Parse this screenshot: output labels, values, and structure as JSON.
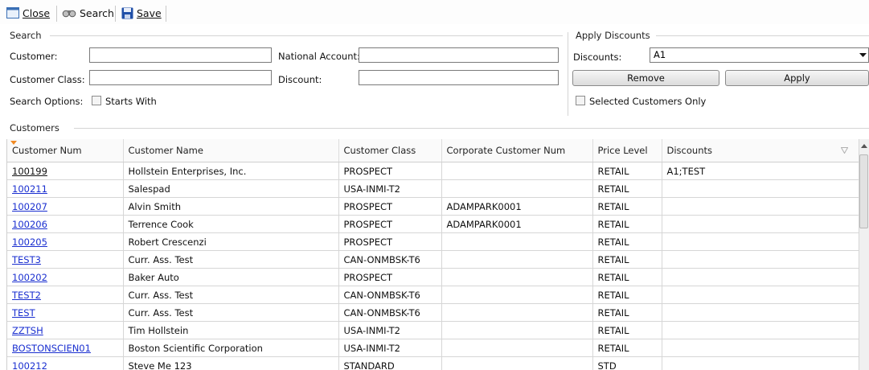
{
  "toolbar": {
    "close_label": "Close",
    "search_label": "Search",
    "save_label": "Save"
  },
  "search": {
    "group_title": "Search",
    "customer_label": "Customer:",
    "customer_value": "",
    "customer_class_label": "Customer Class:",
    "customer_class_value": "",
    "national_account_label": "National Account:",
    "national_account_value": "",
    "discount_label": "Discount:",
    "discount_value": "",
    "search_options_label": "Search Options:",
    "starts_with_label": "Starts With"
  },
  "apply_discounts": {
    "group_title": "Apply Discounts",
    "discounts_label": "Discounts:",
    "discounts_value": "A1",
    "remove_label": "Remove",
    "apply_label": "Apply",
    "selected_only_label": "Selected Customers Only"
  },
  "customers": {
    "group_title": "Customers",
    "columns": [
      "Customer Num",
      "Customer Name",
      "Customer Class",
      "Corporate Customer Num",
      "Price Level",
      "Discounts"
    ],
    "rows": [
      {
        "num": "100199",
        "name": "Hollstein Enterprises, Inc.",
        "class": "PROSPECT",
        "corp": "",
        "price": "RETAIL",
        "discounts": "A1;TEST"
      },
      {
        "num": "100211",
        "name": "Salespad",
        "class": "USA-INMI-T2",
        "corp": "",
        "price": "RETAIL",
        "discounts": ""
      },
      {
        "num": "100207",
        "name": "Alvin Smith",
        "class": "PROSPECT",
        "corp": "ADAMPARK0001",
        "price": "RETAIL",
        "discounts": ""
      },
      {
        "num": "100206",
        "name": "Terrence Cook",
        "class": "PROSPECT",
        "corp": "ADAMPARK0001",
        "price": "RETAIL",
        "discounts": ""
      },
      {
        "num": "100205",
        "name": "Robert Crescenzi",
        "class": "PROSPECT",
        "corp": "",
        "price": "RETAIL",
        "discounts": ""
      },
      {
        "num": "TEST3",
        "name": "Curr. Ass. Test",
        "class": "CAN-ONMBSK-T6",
        "corp": "",
        "price": "RETAIL",
        "discounts": ""
      },
      {
        "num": "100202",
        "name": "Baker Auto",
        "class": "PROSPECT",
        "corp": "",
        "price": "RETAIL",
        "discounts": ""
      },
      {
        "num": "TEST2",
        "name": "Curr. Ass. Test",
        "class": "CAN-ONMBSK-T6",
        "corp": "",
        "price": "RETAIL",
        "discounts": ""
      },
      {
        "num": "TEST",
        "name": "Curr. Ass. Test",
        "class": "CAN-ONMBSK-T6",
        "corp": "",
        "price": "RETAIL",
        "discounts": ""
      },
      {
        "num": "ZZTSH",
        "name": "Tim Hollstein",
        "class": "USA-INMI-T2",
        "corp": "",
        "price": "RETAIL",
        "discounts": ""
      },
      {
        "num": "BOSTONSCIEN01",
        "name": "Boston Scientific Corporation",
        "class": "USA-INMI-T2",
        "corp": "",
        "price": "RETAIL",
        "discounts": ""
      },
      {
        "num": "100212",
        "name": "Steve Me 123",
        "class": "STANDARD",
        "corp": "",
        "price": "STD",
        "discounts": ""
      }
    ]
  },
  "colors": {
    "link": "#1a2fd0",
    "save_icon": "#1f4fa8"
  },
  "icons": [
    "window-close-icon",
    "binoculars-icon",
    "floppy-disk-icon",
    "dropdown-arrow-icon",
    "filter-icon",
    "sort-indicator-icon"
  ]
}
